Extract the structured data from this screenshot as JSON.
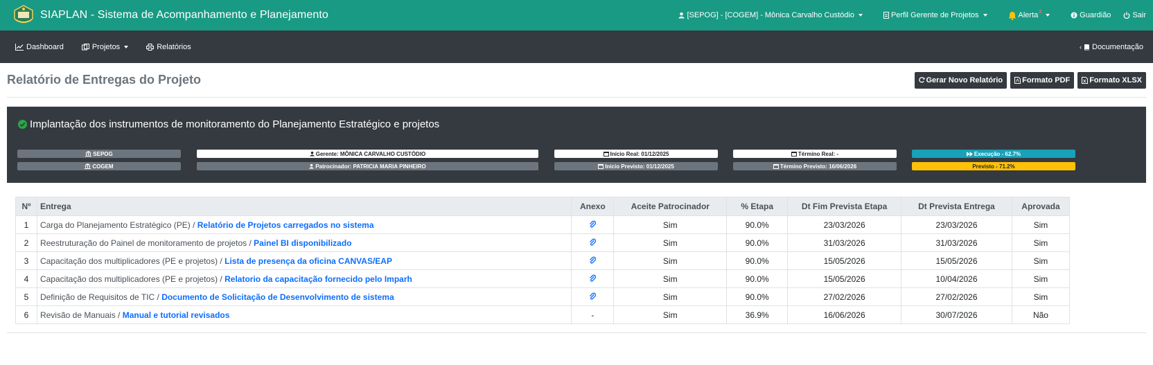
{
  "header": {
    "app_title": "SIAPLAN - Sistema de Acompanhamento e Planejamento",
    "user": "[SEPOG] - [COGEM] - Mônica Carvalho Custódio",
    "profile": "Perfil Gerente de Projetos",
    "alert": "Alerta",
    "alert_count": "2",
    "guardiao": "Guardião",
    "logout": "Sair"
  },
  "nav": {
    "dashboard": "Dashboard",
    "projetos": "Projetos",
    "relatorios": "Relatórios",
    "documentacao": "Documentação"
  },
  "page": {
    "title": "Relatório de Entregas do Projeto",
    "btn_novo": "Gerar Novo Relatório",
    "btn_pdf": "Formato PDF",
    "btn_xlsx": "Formato XLSX"
  },
  "project": {
    "title": "Implantação dos instrumentos de monitoramento do Planejamento Estratégico e projetos",
    "org1": "SEPOG",
    "org2": "COGEM",
    "gerente": "Gerente: MÔNICA CARVALHO CUSTÓDIO",
    "patrocinador": "Patrocinador: PATRICIA MARIA PINHEIRO",
    "inicio_real": "Início Real: 01/12/2025",
    "inicio_previsto": "Início Previsto: 01/12/2025",
    "termino_real": "Término Real: -",
    "termino_previsto": "Término Previsto: 16/06/2026",
    "execucao": "Execução - 62.7%",
    "previsto": "Previsto - 71.2%",
    "colors": {
      "card": "#343a40",
      "execucao": "#17a2b8",
      "previsto": "#ffc107",
      "check": "#28a745"
    }
  },
  "table": {
    "headers": [
      "Nº",
      "Entrega",
      "Anexo",
      "Aceite Patrocinador",
      "% Etapa",
      "Dt Fim Prevista Etapa",
      "Dt Prevista Entrega",
      "Aprovada"
    ],
    "rows": [
      {
        "n": "1",
        "etapa": "Carga do Planejamento Estratégico (PE)",
        "entrega": "Relatório de Projetos carregados no sistema",
        "anexo": "clip",
        "aceite": "Sim",
        "pct": "90.0%",
        "fim_etapa": "23/03/2026",
        "prev_entrega": "23/03/2026",
        "aprovada": "Sim"
      },
      {
        "n": "2",
        "etapa": "Reestruturação do Painel de monitoramento de projetos",
        "entrega": "Painel BI disponibilizado",
        "anexo": "clip",
        "aceite": "Sim",
        "pct": "90.0%",
        "fim_etapa": "31/03/2026",
        "prev_entrega": "31/03/2026",
        "aprovada": "Sim"
      },
      {
        "n": "3",
        "etapa": "Capacitação dos multiplicadores (PE e projetos)",
        "entrega": "Lista de presença da oficina CANVAS/EAP",
        "anexo": "clip",
        "aceite": "Sim",
        "pct": "90.0%",
        "fim_etapa": "15/05/2026",
        "prev_entrega": "15/05/2026",
        "aprovada": "Sim"
      },
      {
        "n": "4",
        "etapa": "Capacitação dos multiplicadores (PE e projetos)",
        "entrega": "Relatorio da capacitação fornecido pelo Imparh",
        "anexo": "clip",
        "aceite": "Sim",
        "pct": "90.0%",
        "fim_etapa": "15/05/2026",
        "prev_entrega": "10/04/2026",
        "aprovada": "Sim"
      },
      {
        "n": "5",
        "etapa": "Definição de Requisitos de TIC",
        "entrega": "Documento de Solicitação de Desenvolvimento de sistema",
        "anexo": "clip",
        "aceite": "Sim",
        "pct": "90.0%",
        "fim_etapa": "27/02/2026",
        "prev_entrega": "27/02/2026",
        "aprovada": "Sim"
      },
      {
        "n": "6",
        "etapa": "Revisão de Manuais",
        "entrega": "Manual e tutorial revisados",
        "anexo": "-",
        "aceite": "Sim",
        "pct": "36.9%",
        "fim_etapa": "16/06/2026",
        "prev_entrega": "30/07/2026",
        "aprovada": "Não"
      }
    ]
  }
}
